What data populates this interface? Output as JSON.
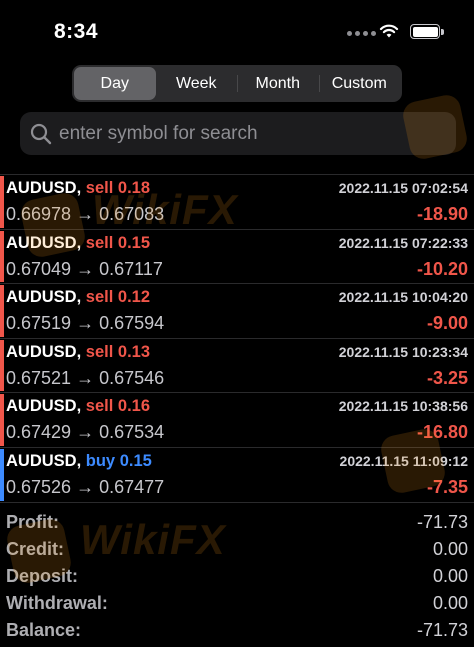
{
  "status_bar": {
    "time": "8:34"
  },
  "period_tabs": [
    {
      "label": "Day",
      "active": true
    },
    {
      "label": "Week",
      "active": false
    },
    {
      "label": "Month",
      "active": false
    },
    {
      "label": "Custom",
      "active": false
    }
  ],
  "search": {
    "placeholder": "enter symbol for search",
    "value": ""
  },
  "deals": [
    {
      "symbol": "AUDUSD,",
      "direction": "sell",
      "volume": "0.18",
      "datetime": "2022.11.15 07:02:54",
      "open": "0.66978",
      "close": "0.67083",
      "profit": "-18.90",
      "color": "#f0564a"
    },
    {
      "symbol": "AUDUSD,",
      "direction": "sell",
      "volume": "0.15",
      "datetime": "2022.11.15 07:22:33",
      "open": "0.67049",
      "close": "0.67117",
      "profit": "-10.20",
      "color": "#f0564a"
    },
    {
      "symbol": "AUDUSD,",
      "direction": "sell",
      "volume": "0.12",
      "datetime": "2022.11.15 10:04:20",
      "open": "0.67519",
      "close": "0.67594",
      "profit": "-9.00",
      "color": "#f0564a"
    },
    {
      "symbol": "AUDUSD,",
      "direction": "sell",
      "volume": "0.13",
      "datetime": "2022.11.15 10:23:34",
      "open": "0.67521",
      "close": "0.67546",
      "profit": "-3.25",
      "color": "#f0564a"
    },
    {
      "symbol": "AUDUSD,",
      "direction": "sell",
      "volume": "0.16",
      "datetime": "2022.11.15 10:38:56",
      "open": "0.67429",
      "close": "0.67534",
      "profit": "-16.80",
      "color": "#f0564a"
    },
    {
      "symbol": "AUDUSD,",
      "direction": "buy",
      "volume": "0.15",
      "datetime": "2022.11.15 11:09:12",
      "open": "0.67526",
      "close": "0.67477",
      "profit": "-7.35",
      "color": "#3d8bff"
    }
  ],
  "price_arrow": "→",
  "summary": [
    {
      "label": "Profit:",
      "value": "-71.73"
    },
    {
      "label": "Credit:",
      "value": "0.00"
    },
    {
      "label": "Deposit:",
      "value": "0.00"
    },
    {
      "label": "Withdrawal:",
      "value": "0.00"
    },
    {
      "label": "Balance:",
      "value": "-71.73"
    }
  ],
  "watermark": {
    "text": "WikiFX",
    "color": "#ff9c1a"
  },
  "colors": {
    "sell": "#f0564a",
    "buy": "#3d8bff",
    "loss": "#f0564a",
    "segment_active": "#636366"
  }
}
